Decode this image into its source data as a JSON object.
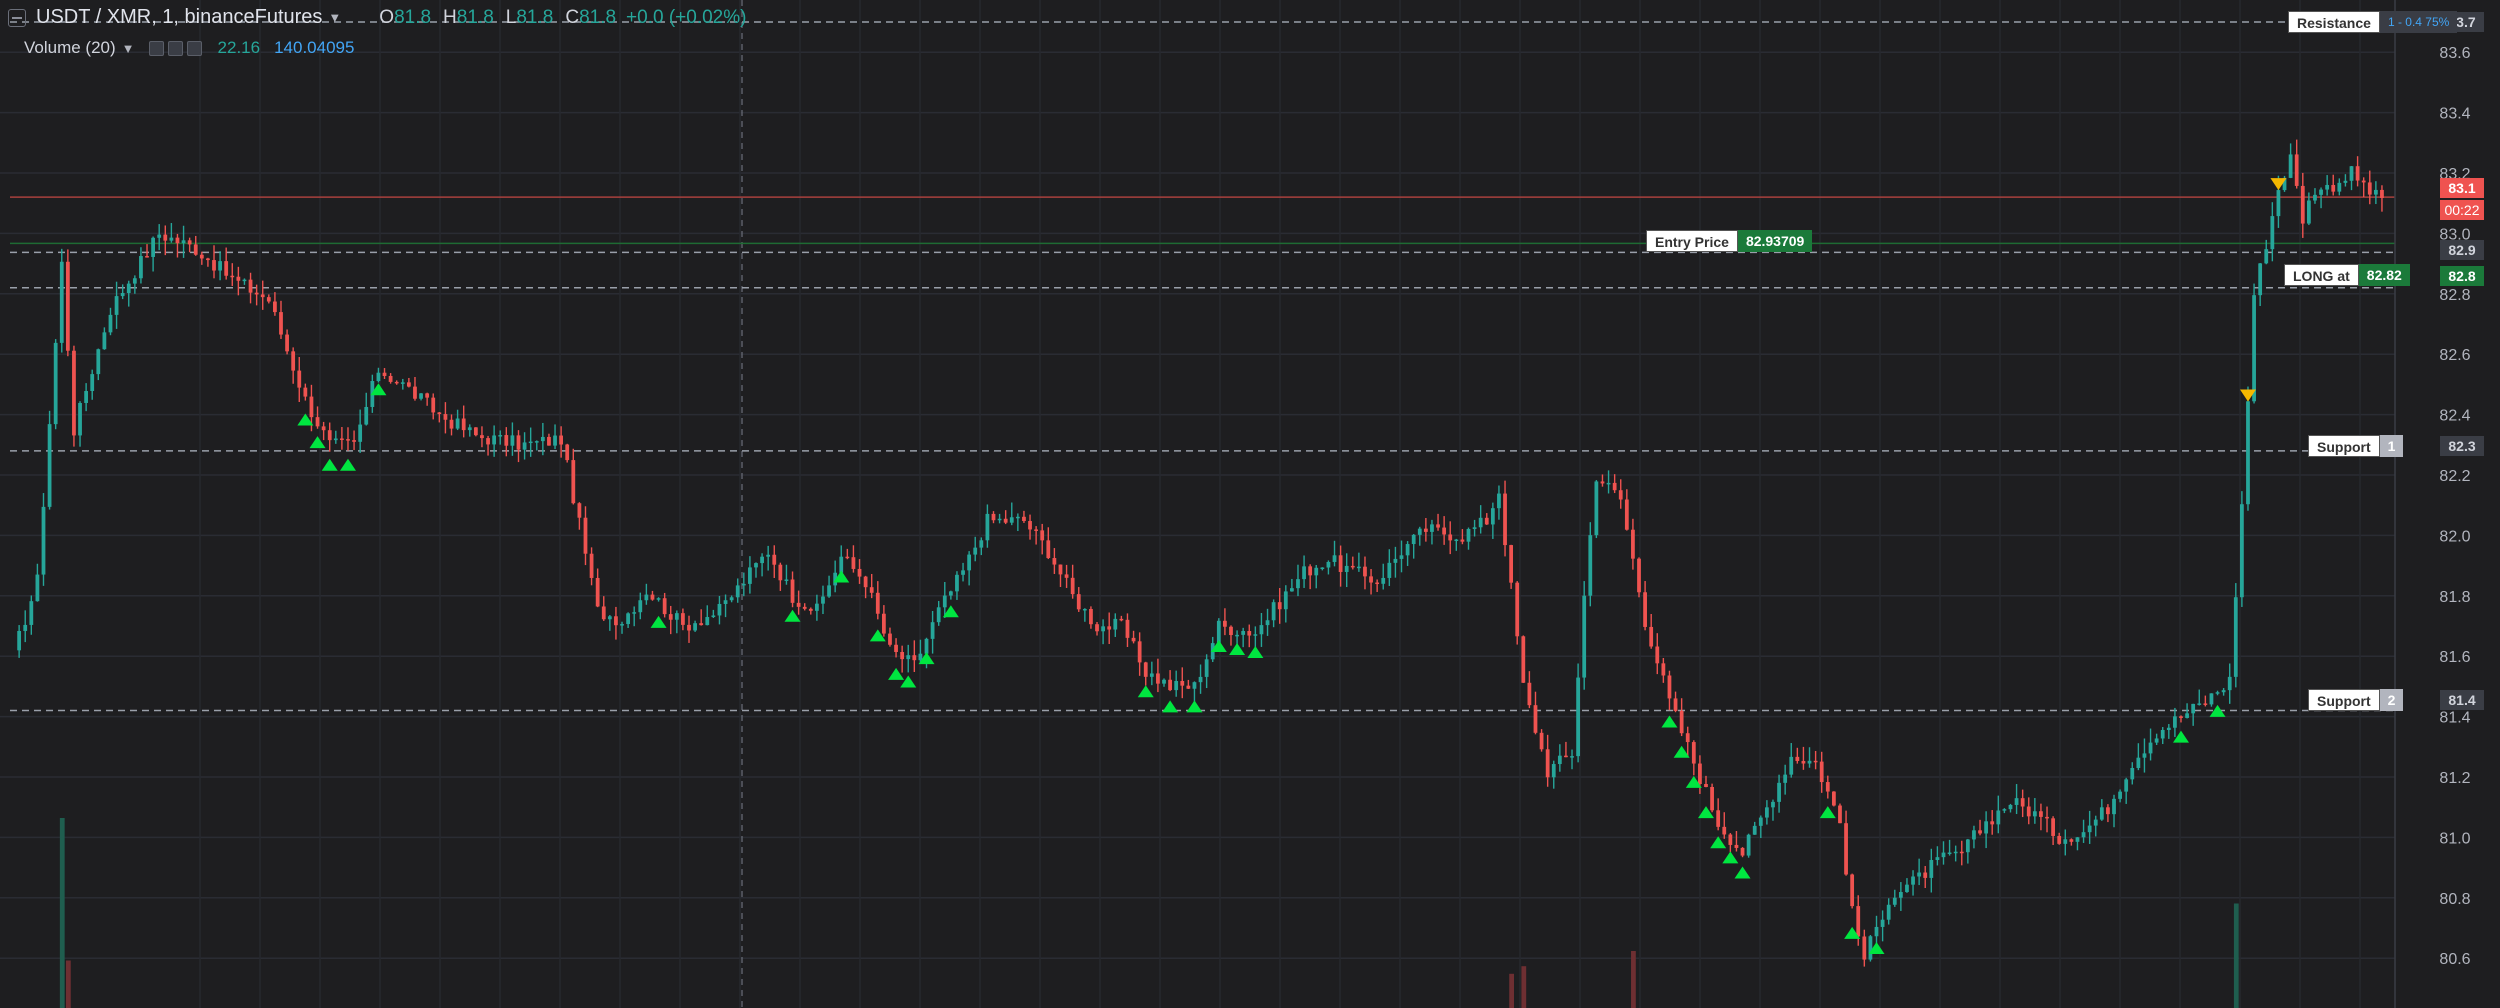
{
  "legend": {
    "symbol": "USDT / XMR, 1, binanceFutures",
    "open_key": "O",
    "open": "81.8",
    "high_key": "H",
    "high": "81.8",
    "low_key": "L",
    "low": "81.8",
    "close_key": "C",
    "close": "81.8",
    "change": "+0.0 (+0.02%)",
    "volume_label": "Volume (20)",
    "volume_a": "22.16",
    "volume_b": "140.04095"
  },
  "axis_badges": {
    "resistance_level": "83.7",
    "red_line_level": "83.1",
    "countdown": "00:22",
    "entry_level": "82.9",
    "long_level": "82.8",
    "support1_level": "82.3",
    "support2_level": "81.4"
  },
  "tags": {
    "resistance": "Resistance",
    "resistance_num": "1 - 0.4 75%",
    "entry_label": "Entry Price",
    "entry_value": "82.93709",
    "long_label": "LONG at",
    "long_value": "82.82",
    "support1_label": "Support",
    "support1_num": "1",
    "support2_label": "Support",
    "support2_num": "2"
  },
  "colors": {
    "background": "#1e1e20",
    "up": "#26a69a",
    "down": "#ef5350",
    "buy_marker": "#00e640",
    "sell_marker": "#f5b800",
    "entry_green": "#1b7a3a",
    "support_badge": "#b2b5be"
  },
  "chart_data": {
    "type": "candlestick",
    "title": "USDT / XMR, 1, binanceFutures",
    "ylim": [
      80.4,
      83.7
    ],
    "y_ticks": [
      83.7,
      83.6,
      83.4,
      83.2,
      83.0,
      82.8,
      82.6,
      82.4,
      82.2,
      82.0,
      81.8,
      81.6,
      81.4,
      81.2,
      81.0,
      80.8,
      80.6,
      80.4
    ],
    "levels": {
      "resistance": 83.7,
      "red_line": 83.12,
      "entry": 82.93709,
      "long": 82.82,
      "support_1": 82.28,
      "support_2": 81.42
    },
    "close_path": [
      [
        0,
        81.6
      ],
      [
        4,
        81.85
      ],
      [
        8,
        82.9
      ],
      [
        10,
        82.35
      ],
      [
        16,
        82.75
      ],
      [
        24,
        83.0
      ],
      [
        30,
        82.95
      ],
      [
        36,
        82.85
      ],
      [
        42,
        82.78
      ],
      [
        48,
        82.45
      ],
      [
        52,
        82.3
      ],
      [
        56,
        82.3
      ],
      [
        60,
        82.55
      ],
      [
        64,
        82.5
      ],
      [
        70,
        82.4
      ],
      [
        76,
        82.33
      ],
      [
        84,
        82.3
      ],
      [
        90,
        82.32
      ],
      [
        96,
        81.75
      ],
      [
        100,
        81.72
      ],
      [
        104,
        81.82
      ],
      [
        110,
        81.7
      ],
      [
        116,
        81.75
      ],
      [
        120,
        81.85
      ],
      [
        124,
        81.95
      ],
      [
        128,
        81.8
      ],
      [
        132,
        81.75
      ],
      [
        136,
        81.93
      ],
      [
        140,
        81.85
      ],
      [
        144,
        81.62
      ],
      [
        148,
        81.57
      ],
      [
        152,
        81.75
      ],
      [
        156,
        81.88
      ],
      [
        160,
        82.05
      ],
      [
        166,
        82.05
      ],
      [
        170,
        81.95
      ],
      [
        174,
        81.8
      ],
      [
        178,
        81.7
      ],
      [
        182,
        81.7
      ],
      [
        186,
        81.55
      ],
      [
        190,
        81.5
      ],
      [
        194,
        81.5
      ],
      [
        198,
        81.7
      ],
      [
        204,
        81.68
      ],
      [
        208,
        81.78
      ],
      [
        212,
        81.88
      ],
      [
        216,
        81.92
      ],
      [
        220,
        81.88
      ],
      [
        224,
        81.85
      ],
      [
        228,
        81.95
      ],
      [
        232,
        82.02
      ],
      [
        238,
        82.0
      ],
      [
        242,
        82.05
      ],
      [
        244,
        82.15
      ],
      [
        248,
        81.5
      ],
      [
        252,
        81.22
      ],
      [
        256,
        81.28
      ],
      [
        258,
        81.8
      ],
      [
        260,
        82.2
      ],
      [
        264,
        82.12
      ],
      [
        268,
        81.72
      ],
      [
        272,
        81.45
      ],
      [
        276,
        81.25
      ],
      [
        280,
        81.05
      ],
      [
        284,
        80.95
      ],
      [
        288,
        81.1
      ],
      [
        292,
        81.27
      ],
      [
        296,
        81.25
      ],
      [
        300,
        81.05
      ],
      [
        302,
        80.75
      ],
      [
        304,
        80.6
      ],
      [
        308,
        80.8
      ],
      [
        312,
        80.85
      ],
      [
        316,
        80.92
      ],
      [
        320,
        80.95
      ],
      [
        324,
        81.05
      ],
      [
        328,
        81.12
      ],
      [
        332,
        81.08
      ],
      [
        336,
        81.0
      ],
      [
        340,
        81.02
      ],
      [
        344,
        81.1
      ],
      [
        348,
        81.25
      ],
      [
        352,
        81.35
      ],
      [
        356,
        81.4
      ],
      [
        360,
        81.45
      ],
      [
        364,
        81.52
      ],
      [
        366,
        82.1
      ],
      [
        368,
        82.8
      ],
      [
        370,
        82.97
      ],
      [
        372,
        83.15
      ],
      [
        374,
        83.25
      ],
      [
        376,
        83.05
      ],
      [
        378,
        83.15
      ],
      [
        380,
        83.15
      ],
      [
        384,
        83.2
      ],
      [
        388,
        83.12
      ]
    ],
    "buy_signals": [
      48,
      50,
      52,
      55,
      60,
      106,
      128,
      136,
      142,
      145,
      147,
      150,
      154,
      186,
      190,
      194,
      198,
      201,
      204,
      272,
      274,
      276,
      278,
      280,
      282,
      284,
      298,
      302,
      306,
      356,
      362
    ],
    "sell_signals": [
      367,
      372
    ],
    "volume_spikes": [
      {
        "index": 8,
        "value": 1.0,
        "direction": "up"
      },
      {
        "index": 9,
        "value": 0.25,
        "direction": "down"
      },
      {
        "index": 246,
        "value": 0.18,
        "direction": "down"
      },
      {
        "index": 248,
        "value": 0.22,
        "direction": "down"
      },
      {
        "index": 266,
        "value": 0.3,
        "direction": "down"
      },
      {
        "index": 365,
        "value": 0.55,
        "direction": "up"
      }
    ]
  }
}
